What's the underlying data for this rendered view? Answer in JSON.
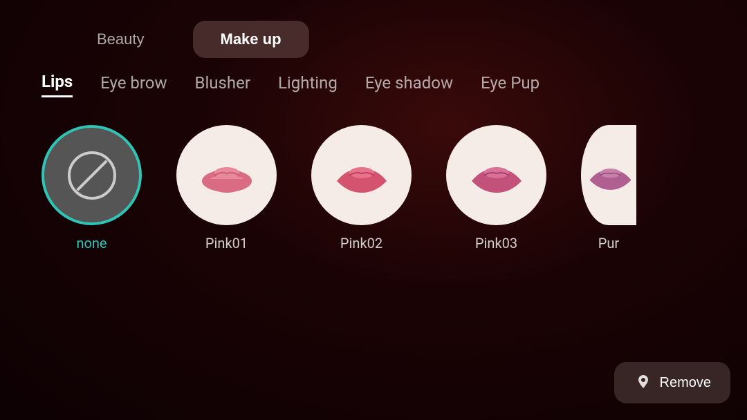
{
  "topBar": {
    "beautyLabel": "Beauty",
    "makeupLabel": "Make up"
  },
  "tabs": [
    {
      "id": "lips",
      "label": "Lips",
      "active": true
    },
    {
      "id": "eyebrow",
      "label": "Eye brow",
      "active": false
    },
    {
      "id": "blusher",
      "label": "Blusher",
      "active": false
    },
    {
      "id": "lighting",
      "label": "Lighting",
      "active": false
    },
    {
      "id": "eyeshadow",
      "label": "Eye shadow",
      "active": false
    },
    {
      "id": "eyepup",
      "label": "Eye Pup",
      "active": false,
      "partial": true
    }
  ],
  "items": [
    {
      "id": "none",
      "label": "none",
      "type": "none",
      "selected": true
    },
    {
      "id": "pink01",
      "label": "Pink01",
      "type": "lip",
      "color": "#d96b82"
    },
    {
      "id": "pink02",
      "label": "Pink02",
      "type": "lip",
      "color": "#d45470"
    },
    {
      "id": "pink03",
      "label": "Pink03",
      "type": "lip",
      "color": "#c2527a"
    },
    {
      "id": "pur",
      "label": "Pur",
      "type": "lip",
      "color": "#b06090",
      "partial": true
    }
  ],
  "removeButton": {
    "label": "Remove"
  },
  "colors": {
    "teal": "#2ec4b6",
    "lipBg": "#f5ece8"
  }
}
